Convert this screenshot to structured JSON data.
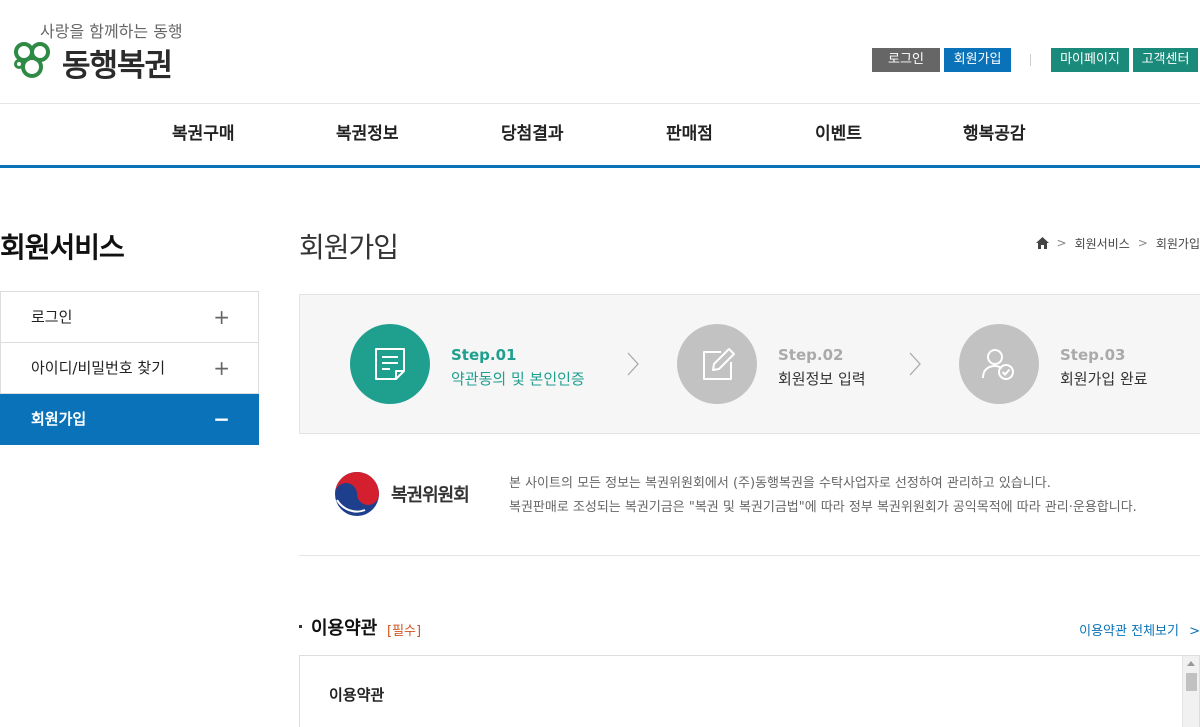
{
  "header": {
    "tagline": "사랑을 함께하는 동행",
    "logo_text": "동행복권",
    "util": {
      "login": "로그인",
      "signup": "회원가입",
      "mypage": "마이페이지",
      "support": "고객센터"
    }
  },
  "colors": {
    "primary_blue": "#0a72b8",
    "teal": "#1f9f8e",
    "dark_gray": "#666666",
    "inactive_gray": "#c2c2c2",
    "required_orange": "#d2541e"
  },
  "gnb": [
    "복권구매",
    "복권정보",
    "당첨결과",
    "판매점",
    "이벤트",
    "행복공감"
  ],
  "lnb": {
    "title": "회원서비스",
    "items": [
      {
        "label": "로그인",
        "symbol": "+"
      },
      {
        "label": "아이디/비밀번호 찾기",
        "symbol": "+"
      },
      {
        "label": "회원가입",
        "symbol": "−"
      }
    ]
  },
  "main": {
    "title": "회원가입",
    "breadcrumb": [
      "회원서비스",
      "회원가입"
    ],
    "steps": [
      {
        "num": "Step.01",
        "desc": "약관동의 및 본인인증",
        "icon": "document-icon"
      },
      {
        "num": "Step.02",
        "desc": "회원정보 입력",
        "icon": "edit-icon"
      },
      {
        "num": "Step.03",
        "desc": "회원가입 완료",
        "icon": "user-check-icon"
      }
    ],
    "notice": {
      "org_name": "복권위원회",
      "line1": "본 사이트의 모든 정보는 복권위원회에서 (주)동행복권을 수탁사업자로 선정하여 관리하고 있습니다.",
      "line2": "복권판매로 조성되는 복권기금은 \"복권 및 복권기금법\"에 따라 정부 복권위원회가 공익목적에 따라 관리·운용합니다."
    },
    "terms": {
      "title": "이용약관",
      "required": "[필수]",
      "view_all": "이용약관 전체보기",
      "box_title": "이용약관"
    }
  }
}
